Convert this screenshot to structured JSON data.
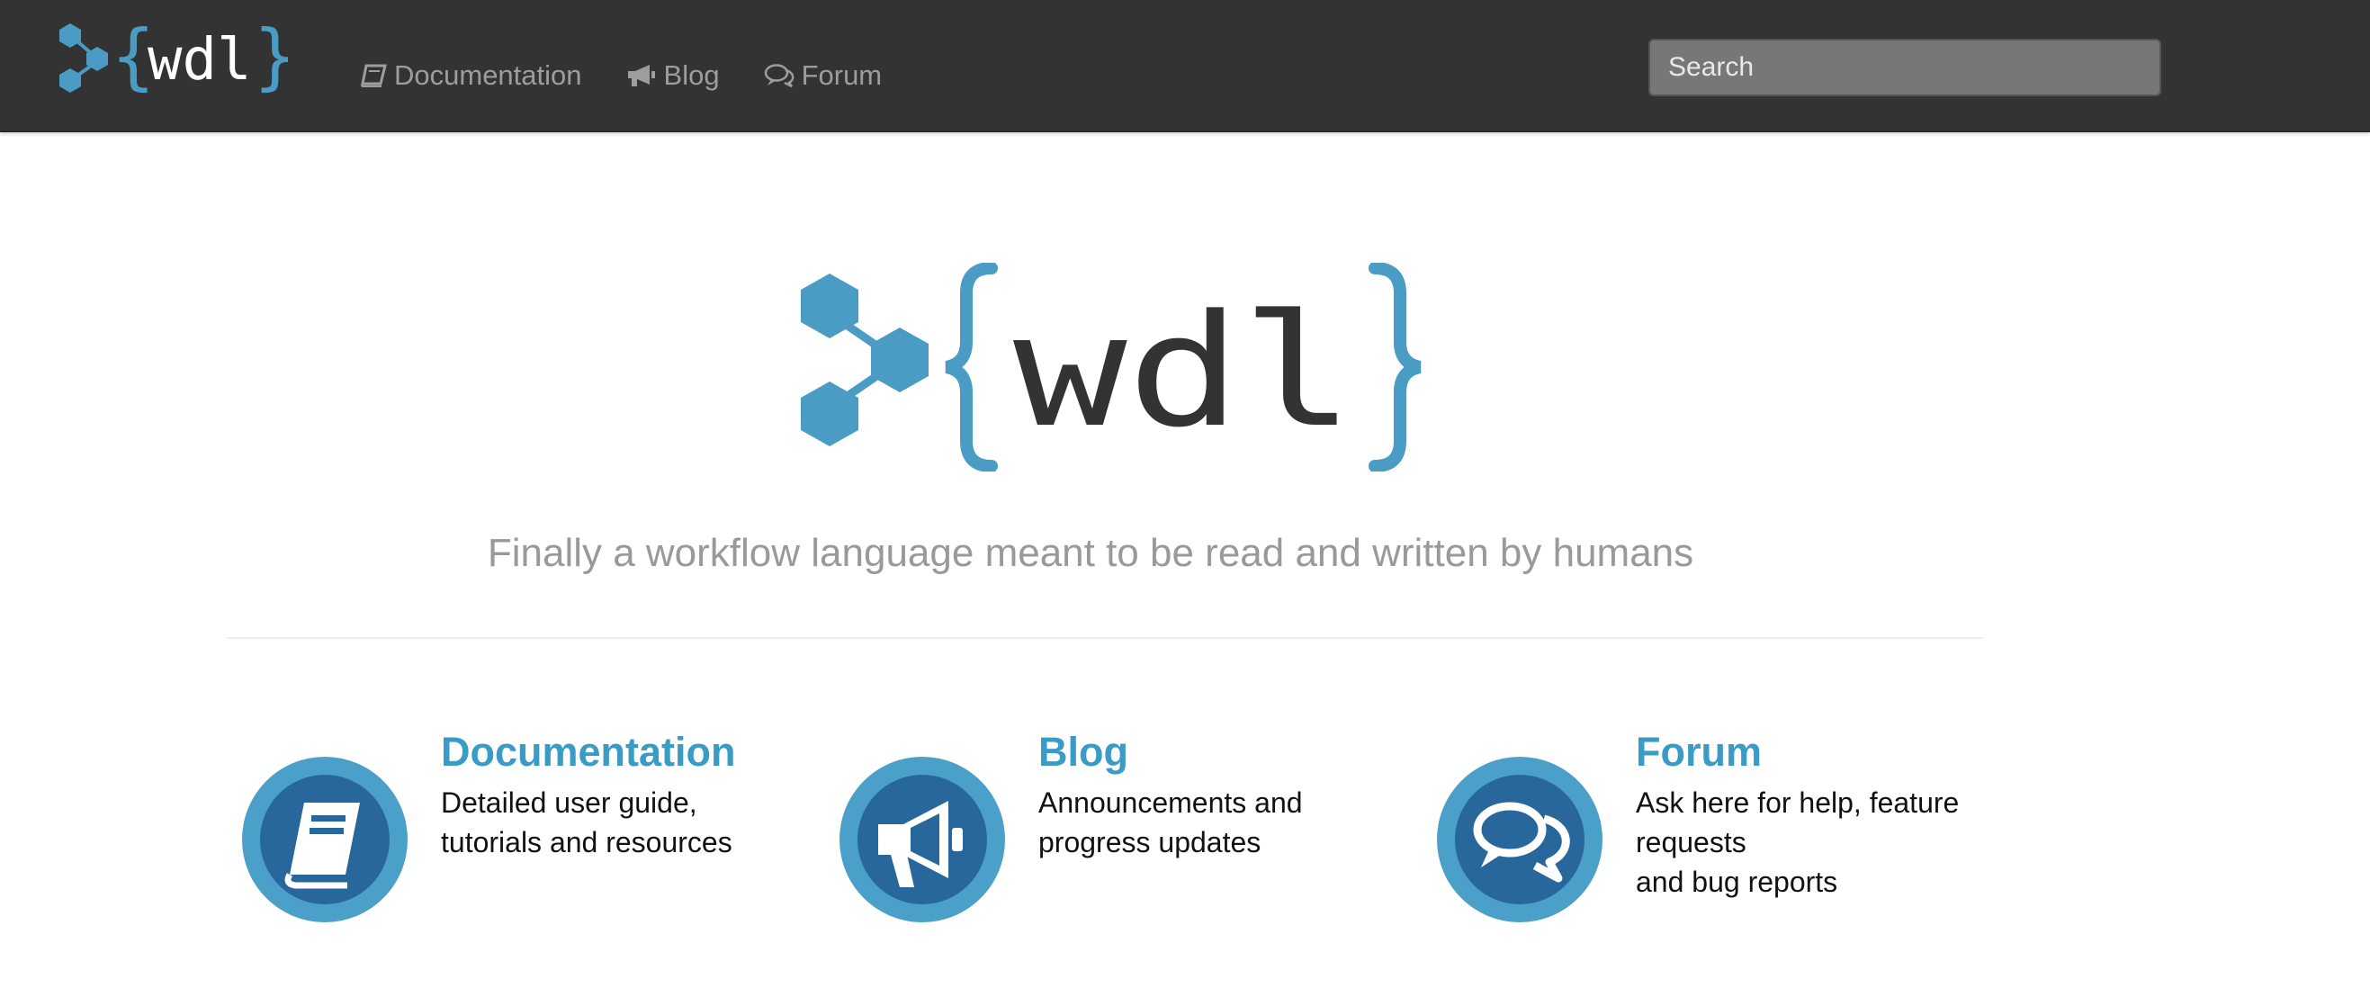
{
  "navbar": {
    "brand": "wdl",
    "links": [
      {
        "label": "Documentation",
        "icon": "book-icon"
      },
      {
        "label": "Blog",
        "icon": "bullhorn-icon"
      },
      {
        "label": "Forum",
        "icon": "comments-icon"
      }
    ],
    "search_placeholder": "Search"
  },
  "hero": {
    "brand": "wdl",
    "tagline": "Finally a workflow language meant to be read and written by humans"
  },
  "features": [
    {
      "title": "Documentation",
      "lines": [
        "Detailed user guide,",
        "tutorials and resources"
      ],
      "icon": "book-icon"
    },
    {
      "title": "Blog",
      "lines": [
        "Announcements and",
        "progress updates"
      ],
      "icon": "bullhorn-icon"
    },
    {
      "title": "Forum",
      "lines": [
        "Ask here for help, feature",
        "requests",
        "and bug reports"
      ],
      "icon": "comments-icon"
    }
  ],
  "colors": {
    "navbar_bg": "#333333",
    "brand_blue": "#4a9cc4",
    "icon_circle_outer": "#4aa0c8",
    "icon_circle_inner": "#27679c",
    "tagline": "#999999",
    "nav_link": "#9d9d9d"
  }
}
